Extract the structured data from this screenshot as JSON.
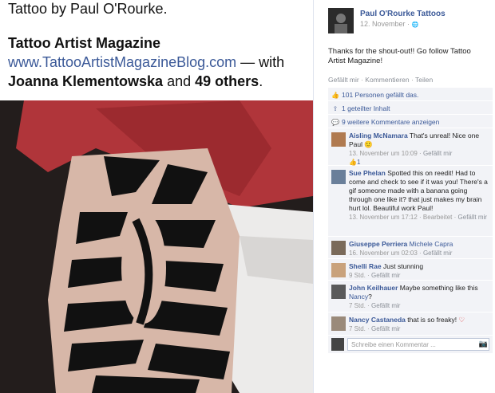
{
  "post": {
    "caption": "Tattoo by Paul O'Rourke.",
    "page_tag": "Tattoo Artist Magazine",
    "link": "www.TattooArtistMagazineBlog.com",
    "with_word": "— with",
    "tagged_person": "Joanna Klementowska",
    "and_word": "and",
    "others": "49 others",
    "period": "."
  },
  "side": {
    "page_name": "Paul O'Rourke Tattoos",
    "date": "12. November · ",
    "globe": "🌐",
    "text": "Thanks for the shout-out!! Go follow Tattoo Artist Magazine!",
    "actions": {
      "like": "Gefällt mir",
      "sep1": " · ",
      "comment": "Kommentieren",
      "sep2": " · ",
      "share": "Teilen"
    },
    "likes": "101 Personen gefällt das.",
    "shares": "1 geteilter Inhalt",
    "more_comments": "9 weitere Kommentare anzeigen"
  },
  "comments": [
    {
      "name": "Aisling McNamara",
      "text": "That's unreal! Nice one Paul 🙂",
      "meta": "13. November um 10:09 · ",
      "like": "Gefällt mir",
      "likes": "1"
    },
    {
      "name": "Sue Phelan",
      "text": "Spotted this on reedit! Had to come and check to see if it was you! There's a gif someone made with a banana going through one like it? that just makes my brain hurt lol. Beautiful work Paul!",
      "meta": "13. November um 17:12 · Bearbeitet · ",
      "like": "Gefällt mir"
    },
    {
      "name": "Giuseppe Perriera",
      "mention": "Michele Capra",
      "text": "",
      "meta": "16. November um 02:03 · ",
      "like": "Gefällt mir"
    },
    {
      "name": "Shelli Rae",
      "text": "Just stunning",
      "meta": "9 Std. · ",
      "like": "Gefällt mir"
    },
    {
      "name": "John Keilhauer",
      "text": "Maybe something like this",
      "mention": "Nancy",
      "end": "?",
      "meta": "7 Std. · ",
      "like": "Gefällt mir"
    },
    {
      "name": "Nancy Castaneda",
      "text": "that is so freaky!",
      "heart": "♡",
      "meta": "7 Std. · ",
      "like": "Gefällt mir"
    }
  ],
  "composer": {
    "placeholder": "Schreibe einen Kommentar ...",
    "camera": "📷"
  }
}
